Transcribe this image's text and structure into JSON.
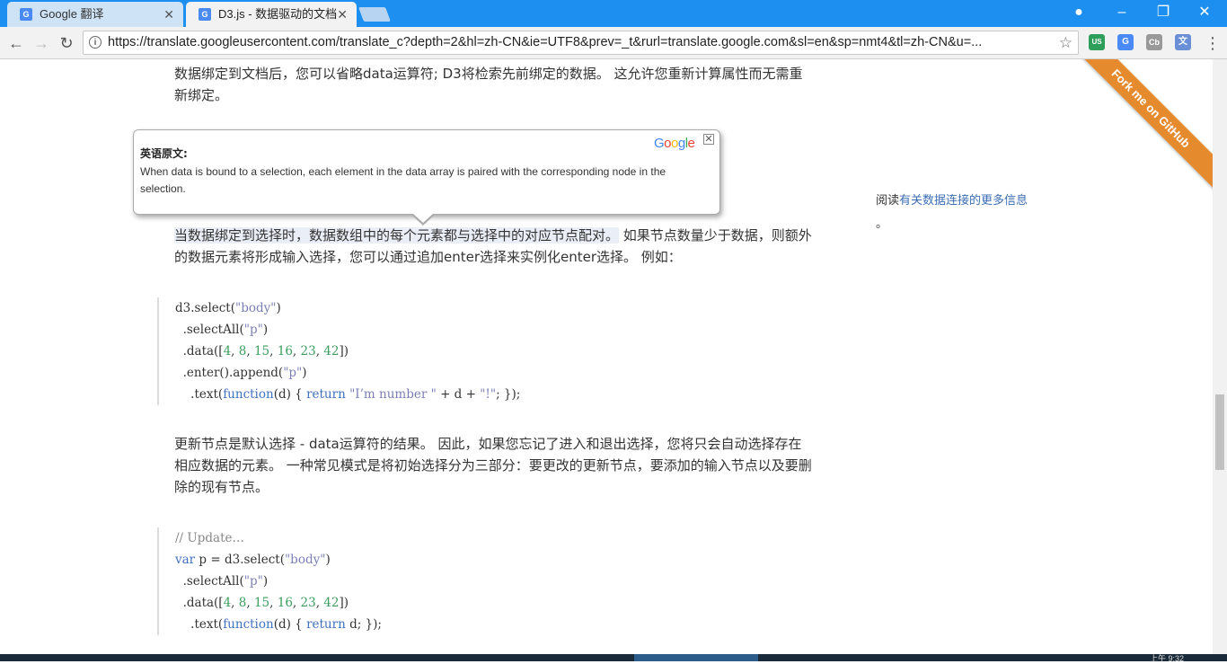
{
  "browser": {
    "tabs": [
      {
        "title": "Google 翻译",
        "active": false
      },
      {
        "title": "D3.js - 数据驱动的文档",
        "active": true
      }
    ],
    "url": "https://translate.googleusercontent.com/translate_c?depth=2&hl=zh-CN&ie=UTF8&prev=_t&rurl=translate.google.com&sl=en&sp=nmt4&tl=zh-CN&u=...",
    "extensions": [
      "translate-extension-icon",
      "google-translate-icon",
      "cb-extension-icon",
      "translate-text-icon"
    ],
    "ext_us_label": "US",
    "ext_cb_label": "Cb"
  },
  "page": {
    "para1": "数据绑定到文档后，您可以省略data运算符; D3将检索先前绑定的数据。 这允许您重新计算属性而无需重新绑定。",
    "hidden_line_tail": "。",
    "para2_highlight": "当数据绑定到选择时，数据数组中的每个元素都与选择中的对应节点配对。",
    "para2_rest": "如果节点数量少于数据，则额外的数据元素将形成输入选择，您可以通过追加enter选择来实例化enter选择。 例如：",
    "para3": "更新节点是默认选择 - data运算符的结果。 因此，如果您忘记了进入和退出选择，您将只会自动选择存在相应数据的元素。 一种常见模式是将初始选择分为三部分：要更改的更新节点，要添加的输入节点以及要删除的现有节点。",
    "sidebar_prefix": "阅读",
    "sidebar_link": "有关数据连接的更多信息",
    "sidebar_suffix": "。",
    "ribbon": "Fork me on GitHub"
  },
  "tooltip": {
    "label": "英语原文:",
    "original": "When data is bound to a selection, each element in the data array is paired with the corresponding node in the selection.",
    "logo": "Google"
  },
  "code1": [
    "d3.select(\"body\")",
    "  .selectAll(\"p\")",
    "  .data([4, 8, 15, 16, 23, 42])",
    "  .enter().append(\"p\")",
    "    .text(function(d) { return \"I’m number \" + d + \"!\"; });"
  ],
  "code2": [
    "// Update…",
    "var p = d3.select(\"body\")",
    "  .selectAll(\"p\")",
    "  .data([4, 8, 15, 16, 23, 42])",
    "    .text(function(d) { return d; });"
  ],
  "taskbar": {
    "clock": "上午 9:32"
  },
  "colors": {
    "chrome_blue": "#1d8ff1",
    "ribbon_orange": "#e68a2e",
    "link_blue": "#3c6eb4"
  }
}
